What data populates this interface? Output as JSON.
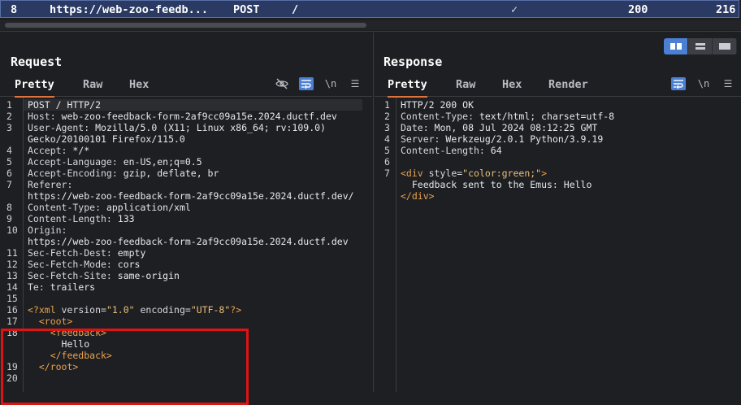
{
  "history_row": {
    "id": "8",
    "host": "https://web-zoo-feedb...",
    "method": "POST",
    "path": "/",
    "check": "✓",
    "status": "200",
    "length": "216"
  },
  "request": {
    "title": "Request",
    "tabs": [
      "Pretty",
      "Raw",
      "Hex"
    ],
    "lines": [
      {
        "n": "1",
        "segs": [
          {
            "t": "POST / HTTP/2",
            "c": "v"
          }
        ]
      },
      {
        "n": "2",
        "segs": [
          {
            "t": "Host: ",
            "c": "k"
          },
          {
            "t": "web-zoo-feedback-form-2af9cc09a15e.2024.ductf.dev",
            "c": "v"
          }
        ]
      },
      {
        "n": "3",
        "segs": [
          {
            "t": "User-Agent: ",
            "c": "k"
          },
          {
            "t": "Mozilla/5.0 (X11; Linux x86_64; rv:109.0)",
            "c": "v"
          }
        ]
      },
      {
        "n": "",
        "segs": [
          {
            "t": "Gecko/20100101 Firefox/115.0",
            "c": "v"
          }
        ]
      },
      {
        "n": "4",
        "segs": [
          {
            "t": "Accept: ",
            "c": "k"
          },
          {
            "t": "*/*",
            "c": "v"
          }
        ]
      },
      {
        "n": "5",
        "segs": [
          {
            "t": "Accept-Language: ",
            "c": "k"
          },
          {
            "t": "en-US,en;q=0.5",
            "c": "v"
          }
        ]
      },
      {
        "n": "6",
        "segs": [
          {
            "t": "Accept-Encoding: ",
            "c": "k"
          },
          {
            "t": "gzip, deflate, br",
            "c": "v"
          }
        ]
      },
      {
        "n": "7",
        "segs": [
          {
            "t": "Referer:",
            "c": "k"
          }
        ]
      },
      {
        "n": "",
        "segs": [
          {
            "t": "https://web-zoo-feedback-form-2af9cc09a15e.2024.ductf.dev/",
            "c": "v"
          }
        ]
      },
      {
        "n": "8",
        "segs": [
          {
            "t": "Content-Type: ",
            "c": "k"
          },
          {
            "t": "application/xml",
            "c": "v"
          }
        ]
      },
      {
        "n": "9",
        "segs": [
          {
            "t": "Content-Length: ",
            "c": "k"
          },
          {
            "t": "133",
            "c": "v"
          }
        ]
      },
      {
        "n": "10",
        "segs": [
          {
            "t": "Origin:",
            "c": "k"
          }
        ]
      },
      {
        "n": "",
        "segs": [
          {
            "t": "https://web-zoo-feedback-form-2af9cc09a15e.2024.ductf.dev",
            "c": "v"
          }
        ]
      },
      {
        "n": "11",
        "segs": [
          {
            "t": "Sec-Fetch-Dest: ",
            "c": "k"
          },
          {
            "t": "empty",
            "c": "v"
          }
        ]
      },
      {
        "n": "12",
        "segs": [
          {
            "t": "Sec-Fetch-Mode: ",
            "c": "k"
          },
          {
            "t": "cors",
            "c": "v"
          }
        ]
      },
      {
        "n": "13",
        "segs": [
          {
            "t": "Sec-Fetch-Site: ",
            "c": "k"
          },
          {
            "t": "same-origin",
            "c": "v"
          }
        ]
      },
      {
        "n": "14",
        "segs": [
          {
            "t": "Te: ",
            "c": "k"
          },
          {
            "t": "trailers",
            "c": "v"
          }
        ]
      },
      {
        "n": "15",
        "segs": []
      },
      {
        "n": "16",
        "segs": [
          {
            "t": "<?xml ",
            "c": "tagc"
          },
          {
            "t": "version=",
            "c": "attrc"
          },
          {
            "t": "\"1.0\"",
            "c": "strc"
          },
          {
            "t": " encoding=",
            "c": "attrc"
          },
          {
            "t": "\"UTF-8\"",
            "c": "strc"
          },
          {
            "t": "?>",
            "c": "tagc"
          }
        ]
      },
      {
        "n": "17",
        "segs": [
          {
            "t": "  <root>",
            "c": "tagc"
          }
        ]
      },
      {
        "n": "18",
        "segs": [
          {
            "t": "    <feedback>",
            "c": "tagc"
          }
        ]
      },
      {
        "n": "",
        "segs": [
          {
            "t": "      Hello",
            "c": "v"
          }
        ]
      },
      {
        "n": "",
        "segs": [
          {
            "t": "    </feedback>",
            "c": "tagc"
          }
        ]
      },
      {
        "n": "19",
        "segs": [
          {
            "t": "  </root>",
            "c": "tagc"
          }
        ]
      },
      {
        "n": "20",
        "segs": []
      }
    ]
  },
  "response": {
    "title": "Response",
    "tabs": [
      "Pretty",
      "Raw",
      "Hex",
      "Render"
    ],
    "lines": [
      {
        "n": "1",
        "segs": [
          {
            "t": "HTTP/2 200 OK",
            "c": "v"
          }
        ]
      },
      {
        "n": "2",
        "segs": [
          {
            "t": "Content-Type: ",
            "c": "k"
          },
          {
            "t": "text/html; charset=utf-8",
            "c": "v"
          }
        ]
      },
      {
        "n": "3",
        "segs": [
          {
            "t": "Date: ",
            "c": "k"
          },
          {
            "t": "Mon, 08 Jul 2024 08:12:25 GMT",
            "c": "v"
          }
        ]
      },
      {
        "n": "4",
        "segs": [
          {
            "t": "Server: ",
            "c": "k"
          },
          {
            "t": "Werkzeug/2.0.1 Python/3.9.19",
            "c": "v"
          }
        ]
      },
      {
        "n": "5",
        "segs": [
          {
            "t": "Content-Length: ",
            "c": "k"
          },
          {
            "t": "64",
            "c": "v"
          }
        ]
      },
      {
        "n": "6",
        "segs": []
      },
      {
        "n": "7",
        "segs": [
          {
            "t": "<div ",
            "c": "tagc"
          },
          {
            "t": "style=",
            "c": "attrc"
          },
          {
            "t": "\"color:green;\"",
            "c": "strc"
          },
          {
            "t": ">",
            "c": "tagc"
          }
        ]
      },
      {
        "n": "",
        "segs": [
          {
            "t": "  Feedback sent to the Emus: Hello",
            "c": "v"
          }
        ]
      },
      {
        "n": "",
        "segs": [
          {
            "t": "</div>",
            "c": "tagc"
          }
        ]
      }
    ]
  },
  "icons": {
    "request_tools": [
      "eye-off-icon",
      "wrap-icon",
      "newline-icon",
      "menu-icon"
    ],
    "response_tools": [
      "wrap-icon",
      "newline-icon",
      "menu-icon"
    ],
    "newline_glyph": "\\n",
    "menu_glyph": "☰"
  },
  "colors": {
    "selection_row": "#2a3a63",
    "accent_tab": "#e0733b",
    "toggle_active": "#4a7fd4",
    "highlight_box": "#e01313",
    "xml_tag": "#e9a24f",
    "xml_string": "#e5c07b"
  }
}
